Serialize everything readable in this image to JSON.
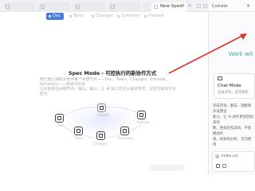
{
  "tabs": [
    {
      "label": "",
      "active": false
    },
    {
      "label": "",
      "active": false
    },
    {
      "label": "",
      "active": false
    },
    {
      "label": "",
      "active": false
    },
    {
      "label": "",
      "active": false
    },
    {
      "label": "New Spec Session",
      "active": true
    }
  ],
  "tab_overflow": "»",
  "editor": {
    "subtabs": [
      {
        "label": "Doc",
        "active": true
      },
      {
        "label": "Tasks",
        "active": false
      },
      {
        "label": "Changes",
        "active": false
      },
      {
        "label": "Summary",
        "active": false
      },
      {
        "label": "Preview",
        "active": false
      }
    ],
    "spec_title": "Spec Mode - 可控执行的新协作方式",
    "spec_desc": "我们建议按照文档中每个关键节点——Doc、Tasks、Changes、Preview、Summary——来进行开发\n让你能够在关键节点，确认、确认，让 AI 和工作充分满足需求，可控可靠的交付能力",
    "diagram_nodes": [
      {
        "label": "文档说明"
      },
      {
        "label": "Doc"
      },
      {
        "label": "Tasks"
      },
      {
        "label": "Changes"
      },
      {
        "label": "Preview"
      },
      {
        "label": "Summary"
      }
    ]
  },
  "side_panel": {
    "title": "Comate",
    "close": "×",
    "work_with": "Work wit",
    "chat_card": {
      "title": "Chat Mode",
      "subtitle": "自由对话，灵活探索"
    },
    "body_text": "完成咨询、解答、理解和开发建议\n能力，让 AI 协作更加轻松高效\n数，更加轻松高效、不受模式约\n束，探索和分析，灵活使用",
    "input": {
      "at": "@",
      "file": "index.css"
    }
  },
  "colors": {
    "accent": "#4a7bd8",
    "arrow": "#d9372b",
    "work_with": "#3fa7a3"
  }
}
